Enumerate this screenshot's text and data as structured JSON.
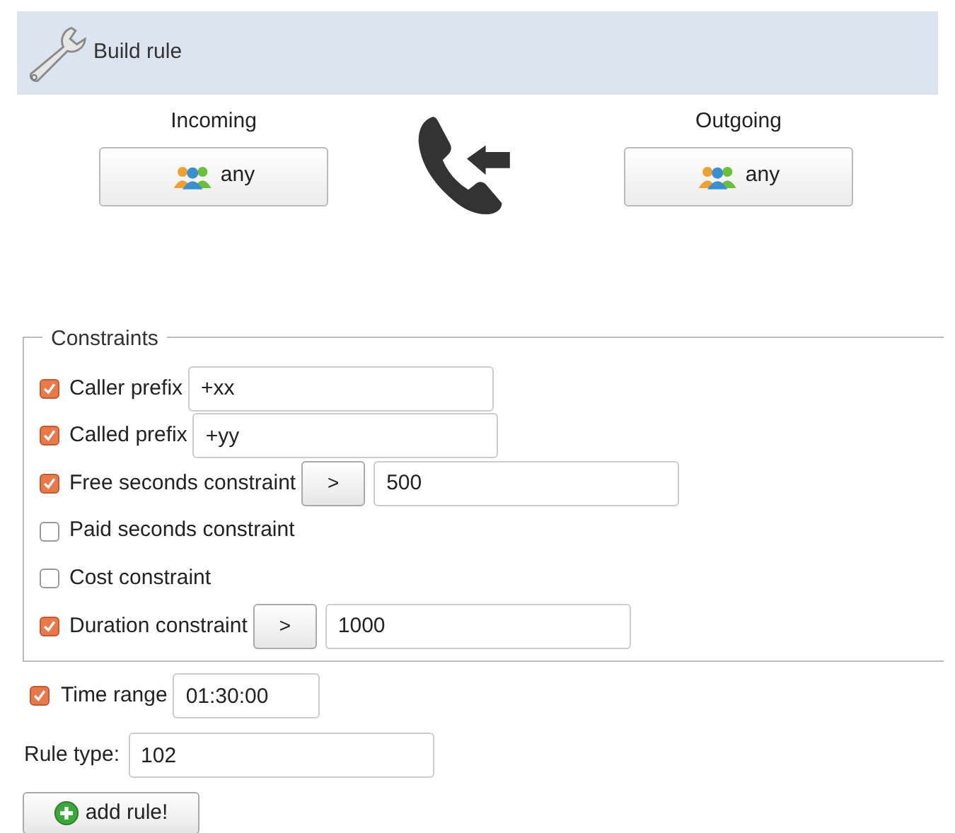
{
  "header": {
    "title": "Build rule"
  },
  "endpoints": [
    {
      "label": "Incoming",
      "button": "any"
    },
    {
      "label": "Outgoing",
      "button": "any"
    }
  ],
  "constraints": {
    "legend": "Constraints",
    "rows": [
      {
        "kind": "text",
        "label": "Caller prefix",
        "checked": true,
        "value": "+xx"
      },
      {
        "kind": "text",
        "label": "Called prefix",
        "checked": true,
        "value": "+yy"
      },
      {
        "kind": "compare",
        "label": "Free seconds constraint",
        "checked": true,
        "operator": ">",
        "value": "500"
      },
      {
        "kind": "plain",
        "label": "Paid seconds constraint",
        "checked": false
      },
      {
        "kind": "plain",
        "label": "Cost constraint",
        "checked": false
      },
      {
        "kind": "compare",
        "label": "Duration constraint",
        "checked": true,
        "operator": ">",
        "value": "1000"
      }
    ]
  },
  "time_range": {
    "label": "Time range",
    "checked": true,
    "value": "01:30:00"
  },
  "rule_type": {
    "label": "Rule type:",
    "value": "102"
  },
  "add_button": "add rule!"
}
